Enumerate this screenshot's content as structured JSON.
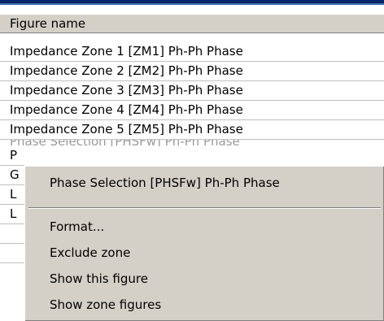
{
  "list": {
    "column_header": "Figure name",
    "rows": [
      "Impedance Zone 1 [ZM1] Ph-Ph Phase",
      "Impedance Zone 2 [ZM2] Ph-Ph Phase",
      "Impedance Zone 3 [ZM3] Ph-Ph Phase",
      "Impedance Zone 4 [ZM4] Ph-Ph Phase",
      "Impedance Zone 5 [ZM5] Ph-Ph Phase"
    ],
    "partial_row": "Phase Selection [PHSFw] Ph-Ph Phase",
    "stub_rows": [
      "P",
      "G",
      "L",
      "L"
    ]
  },
  "context_menu": {
    "header_item": "Phase Selection [PHSFw] Ph-Ph Phase",
    "items": [
      "Format...",
      "Exclude zone",
      "Show this figure",
      "Show zone figures"
    ]
  }
}
